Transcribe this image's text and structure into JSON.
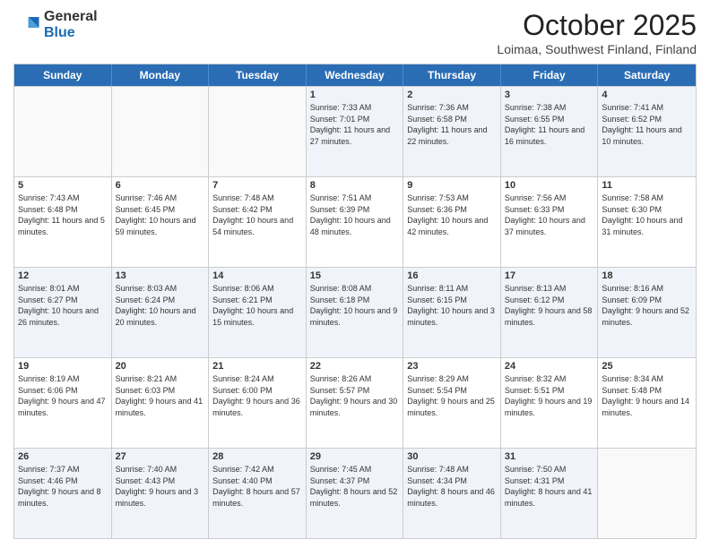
{
  "header": {
    "logo": {
      "line1": "General",
      "line2": "Blue"
    },
    "title": "October 2025",
    "subtitle": "Loimaa, Southwest Finland, Finland"
  },
  "days": [
    "Sunday",
    "Monday",
    "Tuesday",
    "Wednesday",
    "Thursday",
    "Friday",
    "Saturday"
  ],
  "weeks": [
    [
      {
        "day": "",
        "sunrise": "",
        "sunset": "",
        "daylight": ""
      },
      {
        "day": "",
        "sunrise": "",
        "sunset": "",
        "daylight": ""
      },
      {
        "day": "",
        "sunrise": "",
        "sunset": "",
        "daylight": ""
      },
      {
        "day": "1",
        "sunrise": "Sunrise: 7:33 AM",
        "sunset": "Sunset: 7:01 PM",
        "daylight": "Daylight: 11 hours and 27 minutes."
      },
      {
        "day": "2",
        "sunrise": "Sunrise: 7:36 AM",
        "sunset": "Sunset: 6:58 PM",
        "daylight": "Daylight: 11 hours and 22 minutes."
      },
      {
        "day": "3",
        "sunrise": "Sunrise: 7:38 AM",
        "sunset": "Sunset: 6:55 PM",
        "daylight": "Daylight: 11 hours and 16 minutes."
      },
      {
        "day": "4",
        "sunrise": "Sunrise: 7:41 AM",
        "sunset": "Sunset: 6:52 PM",
        "daylight": "Daylight: 11 hours and 10 minutes."
      }
    ],
    [
      {
        "day": "5",
        "sunrise": "Sunrise: 7:43 AM",
        "sunset": "Sunset: 6:48 PM",
        "daylight": "Daylight: 11 hours and 5 minutes."
      },
      {
        "day": "6",
        "sunrise": "Sunrise: 7:46 AM",
        "sunset": "Sunset: 6:45 PM",
        "daylight": "Daylight: 10 hours and 59 minutes."
      },
      {
        "day": "7",
        "sunrise": "Sunrise: 7:48 AM",
        "sunset": "Sunset: 6:42 PM",
        "daylight": "Daylight: 10 hours and 54 minutes."
      },
      {
        "day": "8",
        "sunrise": "Sunrise: 7:51 AM",
        "sunset": "Sunset: 6:39 PM",
        "daylight": "Daylight: 10 hours and 48 minutes."
      },
      {
        "day": "9",
        "sunrise": "Sunrise: 7:53 AM",
        "sunset": "Sunset: 6:36 PM",
        "daylight": "Daylight: 10 hours and 42 minutes."
      },
      {
        "day": "10",
        "sunrise": "Sunrise: 7:56 AM",
        "sunset": "Sunset: 6:33 PM",
        "daylight": "Daylight: 10 hours and 37 minutes."
      },
      {
        "day": "11",
        "sunrise": "Sunrise: 7:58 AM",
        "sunset": "Sunset: 6:30 PM",
        "daylight": "Daylight: 10 hours and 31 minutes."
      }
    ],
    [
      {
        "day": "12",
        "sunrise": "Sunrise: 8:01 AM",
        "sunset": "Sunset: 6:27 PM",
        "daylight": "Daylight: 10 hours and 26 minutes."
      },
      {
        "day": "13",
        "sunrise": "Sunrise: 8:03 AM",
        "sunset": "Sunset: 6:24 PM",
        "daylight": "Daylight: 10 hours and 20 minutes."
      },
      {
        "day": "14",
        "sunrise": "Sunrise: 8:06 AM",
        "sunset": "Sunset: 6:21 PM",
        "daylight": "Daylight: 10 hours and 15 minutes."
      },
      {
        "day": "15",
        "sunrise": "Sunrise: 8:08 AM",
        "sunset": "Sunset: 6:18 PM",
        "daylight": "Daylight: 10 hours and 9 minutes."
      },
      {
        "day": "16",
        "sunrise": "Sunrise: 8:11 AM",
        "sunset": "Sunset: 6:15 PM",
        "daylight": "Daylight: 10 hours and 3 minutes."
      },
      {
        "day": "17",
        "sunrise": "Sunrise: 8:13 AM",
        "sunset": "Sunset: 6:12 PM",
        "daylight": "Daylight: 9 hours and 58 minutes."
      },
      {
        "day": "18",
        "sunrise": "Sunrise: 8:16 AM",
        "sunset": "Sunset: 6:09 PM",
        "daylight": "Daylight: 9 hours and 52 minutes."
      }
    ],
    [
      {
        "day": "19",
        "sunrise": "Sunrise: 8:19 AM",
        "sunset": "Sunset: 6:06 PM",
        "daylight": "Daylight: 9 hours and 47 minutes."
      },
      {
        "day": "20",
        "sunrise": "Sunrise: 8:21 AM",
        "sunset": "Sunset: 6:03 PM",
        "daylight": "Daylight: 9 hours and 41 minutes."
      },
      {
        "day": "21",
        "sunrise": "Sunrise: 8:24 AM",
        "sunset": "Sunset: 6:00 PM",
        "daylight": "Daylight: 9 hours and 36 minutes."
      },
      {
        "day": "22",
        "sunrise": "Sunrise: 8:26 AM",
        "sunset": "Sunset: 5:57 PM",
        "daylight": "Daylight: 9 hours and 30 minutes."
      },
      {
        "day": "23",
        "sunrise": "Sunrise: 8:29 AM",
        "sunset": "Sunset: 5:54 PM",
        "daylight": "Daylight: 9 hours and 25 minutes."
      },
      {
        "day": "24",
        "sunrise": "Sunrise: 8:32 AM",
        "sunset": "Sunset: 5:51 PM",
        "daylight": "Daylight: 9 hours and 19 minutes."
      },
      {
        "day": "25",
        "sunrise": "Sunrise: 8:34 AM",
        "sunset": "Sunset: 5:48 PM",
        "daylight": "Daylight: 9 hours and 14 minutes."
      }
    ],
    [
      {
        "day": "26",
        "sunrise": "Sunrise: 7:37 AM",
        "sunset": "Sunset: 4:46 PM",
        "daylight": "Daylight: 9 hours and 8 minutes."
      },
      {
        "day": "27",
        "sunrise": "Sunrise: 7:40 AM",
        "sunset": "Sunset: 4:43 PM",
        "daylight": "Daylight: 9 hours and 3 minutes."
      },
      {
        "day": "28",
        "sunrise": "Sunrise: 7:42 AM",
        "sunset": "Sunset: 4:40 PM",
        "daylight": "Daylight: 8 hours and 57 minutes."
      },
      {
        "day": "29",
        "sunrise": "Sunrise: 7:45 AM",
        "sunset": "Sunset: 4:37 PM",
        "daylight": "Daylight: 8 hours and 52 minutes."
      },
      {
        "day": "30",
        "sunrise": "Sunrise: 7:48 AM",
        "sunset": "Sunset: 4:34 PM",
        "daylight": "Daylight: 8 hours and 46 minutes."
      },
      {
        "day": "31",
        "sunrise": "Sunrise: 7:50 AM",
        "sunset": "Sunset: 4:31 PM",
        "daylight": "Daylight: 8 hours and 41 minutes."
      },
      {
        "day": "",
        "sunrise": "",
        "sunset": "",
        "daylight": ""
      }
    ]
  ]
}
